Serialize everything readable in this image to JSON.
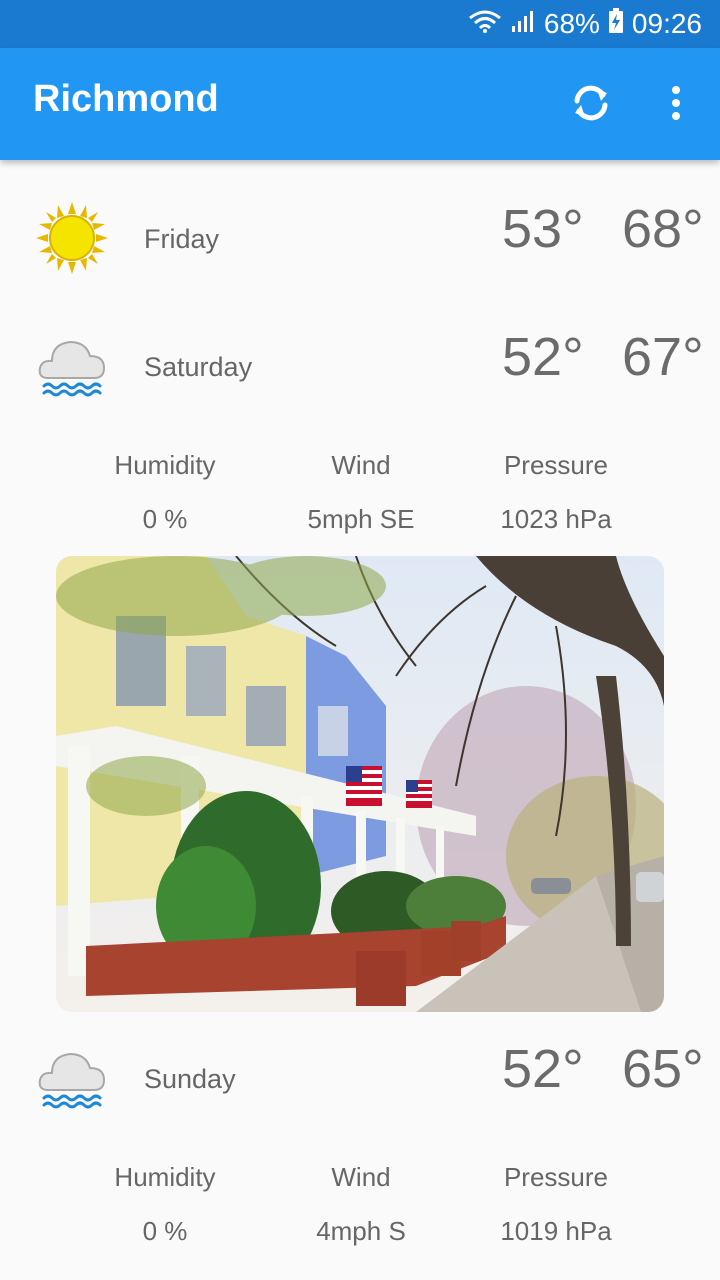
{
  "status_bar": {
    "battery": "68%",
    "time": "09:26",
    "icons": [
      "wifi-icon",
      "signal-icon",
      "battery-charging-icon"
    ]
  },
  "app_bar": {
    "title": "Richmond",
    "actions": [
      "refresh-icon",
      "more-vert-icon"
    ]
  },
  "colors": {
    "status_bar": "#1a7ad0",
    "app_bar": "#2196f3",
    "background": "#fafafa",
    "text": "#666666"
  },
  "forecast": [
    {
      "day": "Friday",
      "icon": "sun-icon",
      "low": "53°",
      "high": "68°"
    },
    {
      "day": "Saturday",
      "icon": "rain-cloud-icon",
      "low": "52°",
      "high": "67°",
      "details": {
        "humidity_label": "Humidity",
        "humidity": "0 %",
        "wind_label": "Wind",
        "wind": "5mph SE",
        "pressure_label": "Pressure",
        "pressure": "1023 hPa"
      }
    },
    {
      "day": "Sunday",
      "icon": "rain-cloud-icon",
      "low": "52°",
      "high": "65°",
      "details": {
        "humidity_label": "Humidity",
        "humidity": "0 %",
        "wind_label": "Wind",
        "wind": "4mph S",
        "pressure_label": "Pressure",
        "pressure": "1019 hPa"
      }
    }
  ],
  "photo": {
    "subject": "city-street-photo"
  }
}
